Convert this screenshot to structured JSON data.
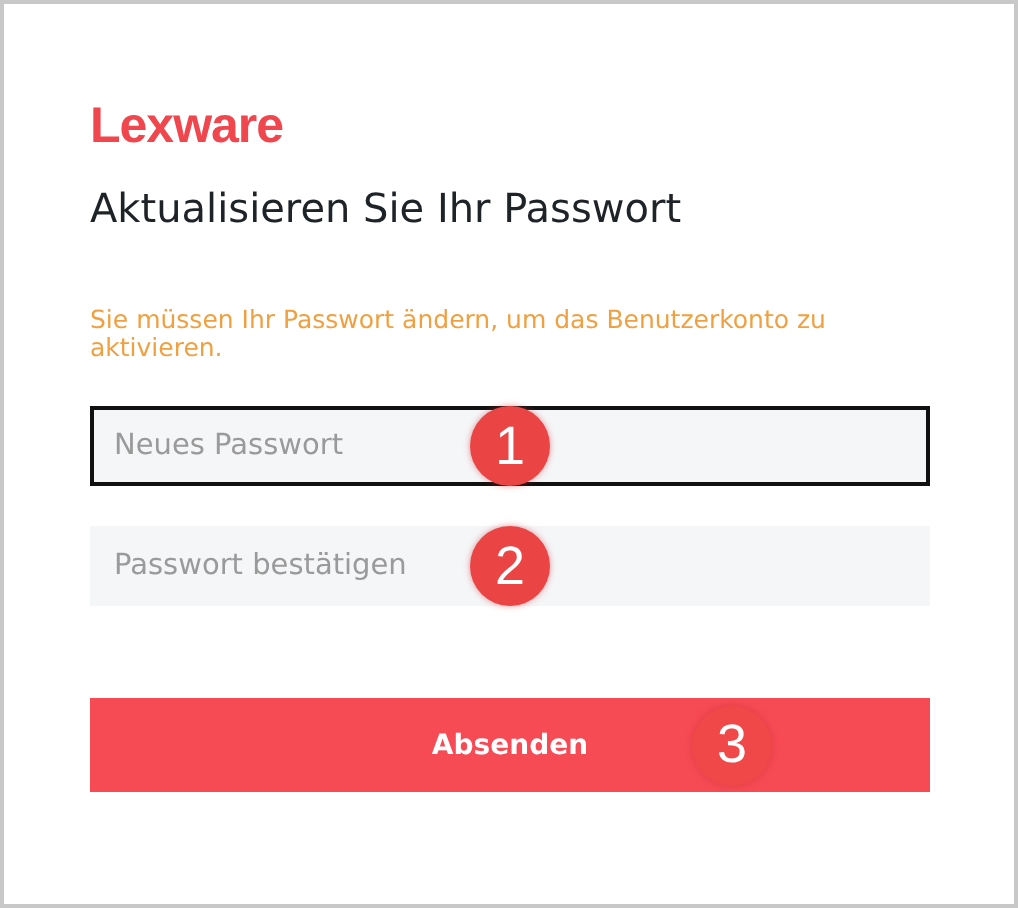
{
  "logo": "Lexware",
  "title": "Aktualisieren Sie Ihr Passwort",
  "message": "Sie müssen Ihr Passwort ändern, um das Benutzerkonto zu aktivieren.",
  "fields": [
    {
      "placeholder": "Neues Passwort",
      "focused": true,
      "marker": "1"
    },
    {
      "placeholder": "Passwort bestätigen",
      "focused": false,
      "marker": "2"
    }
  ],
  "submit": {
    "label": "Absenden",
    "marker": "3"
  }
}
